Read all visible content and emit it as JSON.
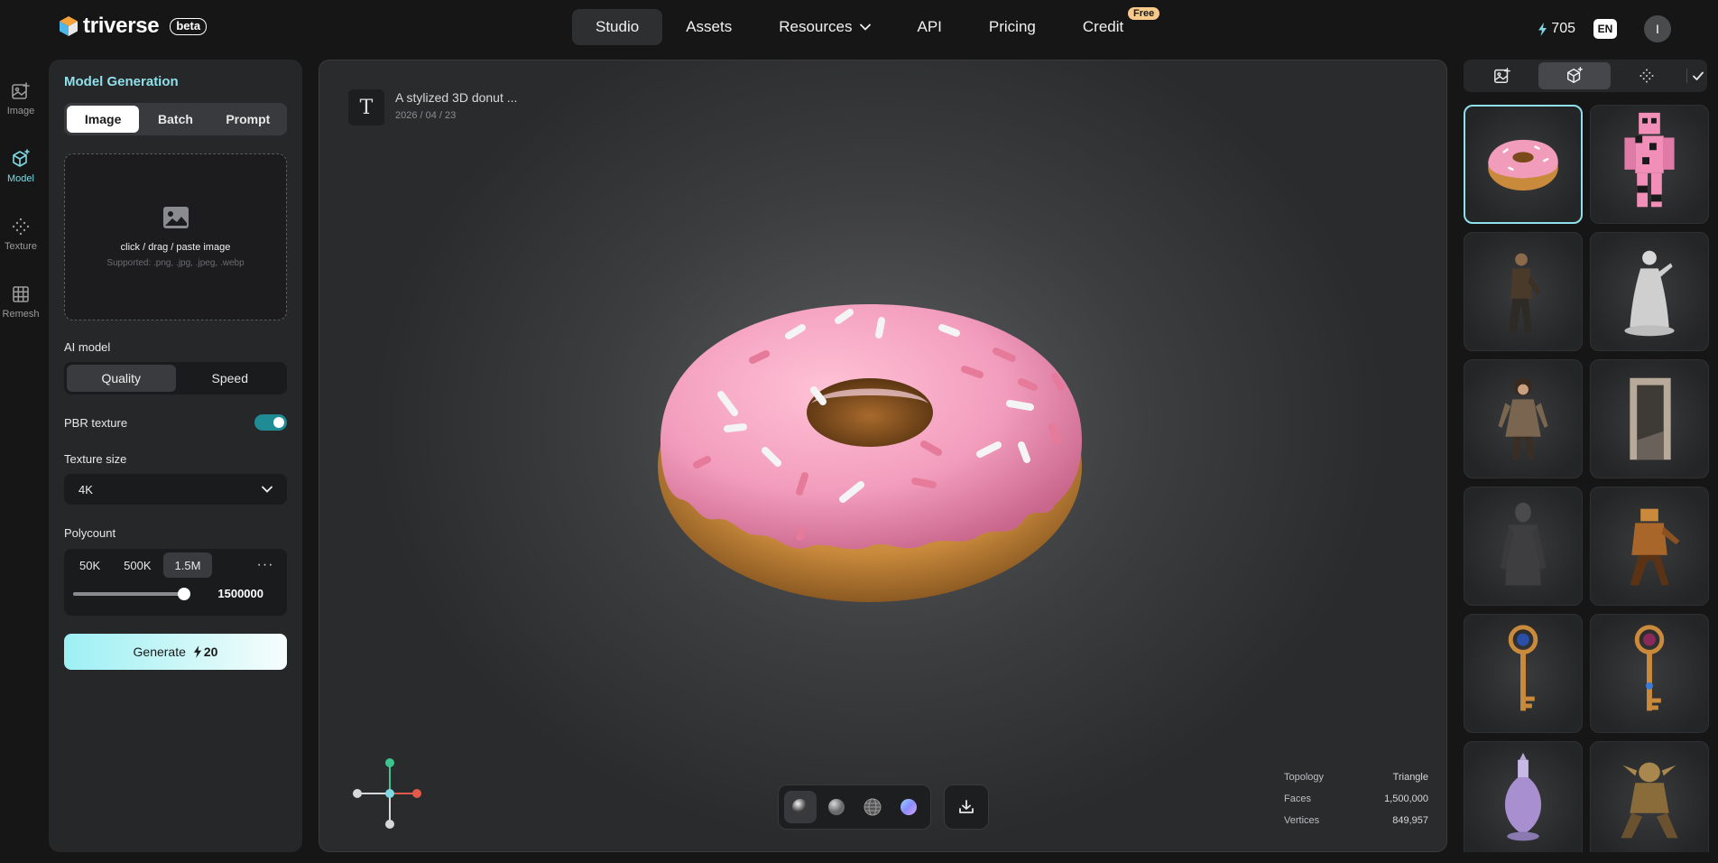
{
  "brand": {
    "name": "triverse",
    "badge": "beta"
  },
  "nav": {
    "items": [
      {
        "label": "Studio",
        "active": true
      },
      {
        "label": "Assets"
      },
      {
        "label": "Resources"
      },
      {
        "label": "API"
      },
      {
        "label": "Pricing"
      },
      {
        "label": "Credit"
      }
    ],
    "free_badge": "Free"
  },
  "header": {
    "credits": "705",
    "language": "EN",
    "avatar_initial": "I"
  },
  "rail": {
    "items": [
      {
        "label": "Image",
        "icon": "image-icon"
      },
      {
        "label": "Model",
        "icon": "cube-icon",
        "active": true
      },
      {
        "label": "Texture",
        "icon": "texture-icon"
      },
      {
        "label": "Remesh",
        "icon": "grid-icon"
      }
    ]
  },
  "panel": {
    "title": "Model Generation",
    "tabs": [
      "Image",
      "Batch",
      "Prompt"
    ],
    "active_tab": "Image",
    "upload": {
      "main": "click / drag / paste image",
      "sub": "Supported: .png, .jpg, .jpeg, .webp"
    },
    "ai_model": {
      "label": "AI model",
      "options": [
        "Quality",
        "Speed"
      ],
      "selected": "Quality"
    },
    "pbr": {
      "label": "PBR texture",
      "enabled": true
    },
    "texture_size": {
      "label": "Texture size",
      "value": "4K"
    },
    "polycount": {
      "label": "Polycount",
      "options": [
        "50K",
        "500K",
        "1.5M"
      ],
      "selected": "1.5M",
      "more": "···",
      "value": "1500000",
      "fraction": 0.98
    },
    "generate": {
      "label": "Generate",
      "cost": "20"
    }
  },
  "viewport": {
    "prompt_icon": "T",
    "prompt": "A stylized 3D donut ...",
    "date": "2026 / 04 / 23",
    "stats": [
      {
        "key": "Topology",
        "value": "Triangle"
      },
      {
        "key": "Faces",
        "value": "1,500,000"
      },
      {
        "key": "Vertices",
        "value": "849,957"
      }
    ]
  },
  "colors": {
    "accent": "#8fe0ea",
    "toggle": "#1f8b95",
    "free_badge": "#f7c98b"
  }
}
